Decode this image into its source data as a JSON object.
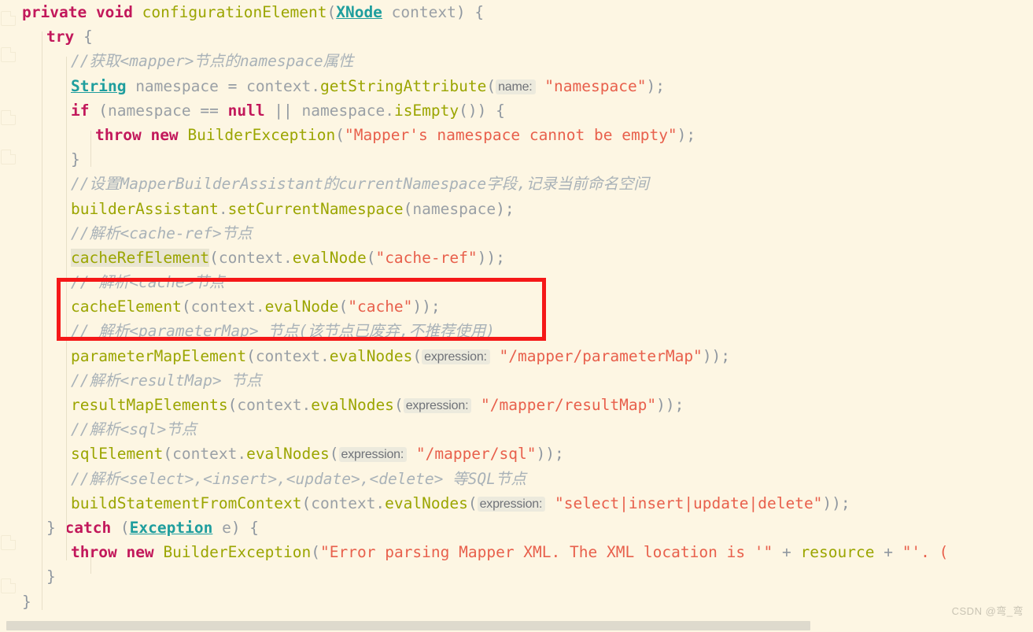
{
  "editor": {
    "background_color": "#fdf6e3",
    "keyword_color": "#c2185b",
    "method_color": "#9ba500",
    "string_color": "#e8604c",
    "comment_color": "#a9b2b8",
    "plain_color": "#9aa0a6",
    "type_color": "#1f9e9e",
    "annotation_color": "#f51818",
    "language": "Java"
  },
  "watermark": {
    "text": "CSDN @弯_弯"
  },
  "annotation": {
    "box_label": "red-highlight-box",
    "color": "#f51818",
    "covers_lines": [
      "// 解析<cache>节点",
      "cacheElement(context.evalNode(\"cache\"));"
    ]
  },
  "code": {
    "lines": [
      {
        "id": "line-1",
        "indent": 0,
        "tokens": [
          {
            "t": "kw",
            "v": "private"
          },
          {
            "t": "pln",
            "v": " "
          },
          {
            "t": "kw",
            "v": "void"
          },
          {
            "t": "pln",
            "v": " "
          },
          {
            "t": "fn",
            "v": "configurationElement"
          },
          {
            "t": "op",
            "v": "("
          },
          {
            "t": "type",
            "v": "XNode"
          },
          {
            "t": "pln",
            "v": " context"
          },
          {
            "t": "op",
            "v": ") {"
          }
        ]
      },
      {
        "id": "line-2",
        "indent": 1,
        "tokens": [
          {
            "t": "kw",
            "v": "try"
          },
          {
            "t": "op",
            "v": " {"
          }
        ]
      },
      {
        "id": "line-3",
        "indent": 2,
        "tokens": [
          {
            "t": "cmt",
            "v": "//获取<mapper>节点的namespace属性"
          }
        ]
      },
      {
        "id": "line-4",
        "indent": 2,
        "tokens": [
          {
            "t": "type",
            "v": "String"
          },
          {
            "t": "pln",
            "v": " namespace "
          },
          {
            "t": "op",
            "v": "= "
          },
          {
            "t": "pln",
            "v": "context."
          },
          {
            "t": "fn",
            "v": "getStringAttribute"
          },
          {
            "t": "op",
            "v": "("
          },
          {
            "t": "hint",
            "v": "name:"
          },
          {
            "t": "str",
            "v": " \"namespace\""
          },
          {
            "t": "op",
            "v": ");"
          }
        ]
      },
      {
        "id": "line-5",
        "indent": 2,
        "tokens": [
          {
            "t": "kw",
            "v": "if"
          },
          {
            "t": "op",
            "v": " ("
          },
          {
            "t": "pln",
            "v": "namespace "
          },
          {
            "t": "op",
            "v": "== "
          },
          {
            "t": "kw",
            "v": "null"
          },
          {
            "t": "op",
            "v": " || "
          },
          {
            "t": "pln",
            "v": "namespace."
          },
          {
            "t": "fn",
            "v": "isEmpty"
          },
          {
            "t": "op",
            "v": "()) {"
          }
        ]
      },
      {
        "id": "line-6",
        "indent": 3,
        "tokens": [
          {
            "t": "kw",
            "v": "throw"
          },
          {
            "t": "pln",
            "v": " "
          },
          {
            "t": "kw",
            "v": "new"
          },
          {
            "t": "pln",
            "v": " "
          },
          {
            "t": "fn",
            "v": "BuilderException"
          },
          {
            "t": "op",
            "v": "("
          },
          {
            "t": "str",
            "v": "\"Mapper's namespace cannot be empty\""
          },
          {
            "t": "op",
            "v": ");"
          }
        ]
      },
      {
        "id": "line-7",
        "indent": 2,
        "tokens": [
          {
            "t": "op",
            "v": "}"
          }
        ]
      },
      {
        "id": "line-8",
        "indent": 2,
        "tokens": [
          {
            "t": "cmt",
            "v": "//设置MapperBuilderAssistant的currentNamespace字段,记录当前命名空间"
          }
        ]
      },
      {
        "id": "line-9",
        "indent": 2,
        "tokens": [
          {
            "t": "fn",
            "v": "builderAssistant"
          },
          {
            "t": "pln",
            "v": "."
          },
          {
            "t": "fn",
            "v": "setCurrentNamespace"
          },
          {
            "t": "op",
            "v": "("
          },
          {
            "t": "pln",
            "v": "namespace"
          },
          {
            "t": "op",
            "v": ");"
          }
        ]
      },
      {
        "id": "line-10",
        "indent": 2,
        "tokens": [
          {
            "t": "cmt",
            "v": "//解析<cache-ref>节点"
          }
        ]
      },
      {
        "id": "line-11",
        "indent": 2,
        "tokens": [
          {
            "t": "fn idhl",
            "v": "cacheRefElement"
          },
          {
            "t": "op",
            "v": "("
          },
          {
            "t": "pln",
            "v": "context."
          },
          {
            "t": "fn",
            "v": "evalNode"
          },
          {
            "t": "op",
            "v": "("
          },
          {
            "t": "str",
            "v": "\"cache-ref\""
          },
          {
            "t": "op",
            "v": "));"
          }
        ]
      },
      {
        "id": "line-12",
        "indent": 2,
        "tokens": [
          {
            "t": "cmt",
            "v": "// 解析<cache>节点"
          }
        ]
      },
      {
        "id": "line-13",
        "indent": 2,
        "tokens": [
          {
            "t": "fn",
            "v": "cacheElement"
          },
          {
            "t": "op",
            "v": "("
          },
          {
            "t": "pln",
            "v": "context."
          },
          {
            "t": "fn",
            "v": "evalNode"
          },
          {
            "t": "op",
            "v": "("
          },
          {
            "t": "str",
            "v": "\"cache\""
          },
          {
            "t": "op",
            "v": "));"
          }
        ]
      },
      {
        "id": "line-14",
        "indent": 2,
        "tokens": [
          {
            "t": "cmt",
            "v": "// 解析<parameterMap> 节点(该节点已废弃,不推荐使用)"
          }
        ]
      },
      {
        "id": "line-15",
        "indent": 2,
        "tokens": [
          {
            "t": "fn",
            "v": "parameterMapElement"
          },
          {
            "t": "op",
            "v": "("
          },
          {
            "t": "pln",
            "v": "context."
          },
          {
            "t": "fn",
            "v": "evalNodes"
          },
          {
            "t": "op",
            "v": "("
          },
          {
            "t": "hint",
            "v": "expression:"
          },
          {
            "t": "str",
            "v": " \"/mapper/parameterMap\""
          },
          {
            "t": "op",
            "v": "));"
          }
        ]
      },
      {
        "id": "line-16",
        "indent": 2,
        "tokens": [
          {
            "t": "cmt",
            "v": "//解析<resultMap> 节点"
          }
        ]
      },
      {
        "id": "line-17",
        "indent": 2,
        "tokens": [
          {
            "t": "fn",
            "v": "resultMapElements"
          },
          {
            "t": "op",
            "v": "("
          },
          {
            "t": "pln",
            "v": "context."
          },
          {
            "t": "fn",
            "v": "evalNodes"
          },
          {
            "t": "op",
            "v": "("
          },
          {
            "t": "hint",
            "v": "expression:"
          },
          {
            "t": "str",
            "v": " \"/mapper/resultMap\""
          },
          {
            "t": "op",
            "v": "));"
          }
        ]
      },
      {
        "id": "line-18",
        "indent": 2,
        "tokens": [
          {
            "t": "cmt",
            "v": "//解析<sql>节点"
          }
        ]
      },
      {
        "id": "line-19",
        "indent": 2,
        "tokens": [
          {
            "t": "fn",
            "v": "sqlElement"
          },
          {
            "t": "op",
            "v": "("
          },
          {
            "t": "pln",
            "v": "context."
          },
          {
            "t": "fn",
            "v": "evalNodes"
          },
          {
            "t": "op",
            "v": "("
          },
          {
            "t": "hint",
            "v": "expression:"
          },
          {
            "t": "str",
            "v": " \"/mapper/sql\""
          },
          {
            "t": "op",
            "v": "));"
          }
        ]
      },
      {
        "id": "line-20",
        "indent": 2,
        "tokens": [
          {
            "t": "cmt",
            "v": "//解析<select>,<insert>,<update>,<delete> 等SQL节点"
          }
        ]
      },
      {
        "id": "line-21",
        "indent": 2,
        "tokens": [
          {
            "t": "fn",
            "v": "buildStatementFromContext"
          },
          {
            "t": "op",
            "v": "("
          },
          {
            "t": "pln",
            "v": "context."
          },
          {
            "t": "fn",
            "v": "evalNodes"
          },
          {
            "t": "op",
            "v": "("
          },
          {
            "t": "hint",
            "v": "expression:"
          },
          {
            "t": "str",
            "v": " \"select|insert|update|delete\""
          },
          {
            "t": "op",
            "v": "));"
          }
        ]
      },
      {
        "id": "line-22",
        "indent": 1,
        "tokens": [
          {
            "t": "op",
            "v": "} "
          },
          {
            "t": "kw",
            "v": "catch"
          },
          {
            "t": "op",
            "v": " ("
          },
          {
            "t": "type",
            "v": "Exception"
          },
          {
            "t": "pln",
            "v": " e"
          },
          {
            "t": "op",
            "v": ") {"
          }
        ]
      },
      {
        "id": "line-23",
        "indent": 2,
        "tokens": [
          {
            "t": "kw",
            "v": "throw"
          },
          {
            "t": "pln",
            "v": " "
          },
          {
            "t": "kw",
            "v": "new"
          },
          {
            "t": "pln",
            "v": " "
          },
          {
            "t": "fn",
            "v": "BuilderException"
          },
          {
            "t": "op",
            "v": "("
          },
          {
            "t": "str",
            "v": "\"Error parsing Mapper XML. The XML location is '\""
          },
          {
            "t": "op",
            "v": " + "
          },
          {
            "t": "fn",
            "v": "resource"
          },
          {
            "t": "op",
            "v": " + "
          },
          {
            "t": "str",
            "v": "\"'. ("
          },
          {
            "t": "op",
            "v": ""
          }
        ]
      },
      {
        "id": "line-24",
        "indent": 1,
        "tokens": [
          {
            "t": "op",
            "v": "}"
          }
        ]
      },
      {
        "id": "line-25",
        "indent": 0,
        "tokens": [
          {
            "t": "op",
            "v": "}"
          }
        ]
      }
    ]
  },
  "scrollbar": {
    "orientation": "horizontal",
    "thumb_fraction": 0.78
  }
}
